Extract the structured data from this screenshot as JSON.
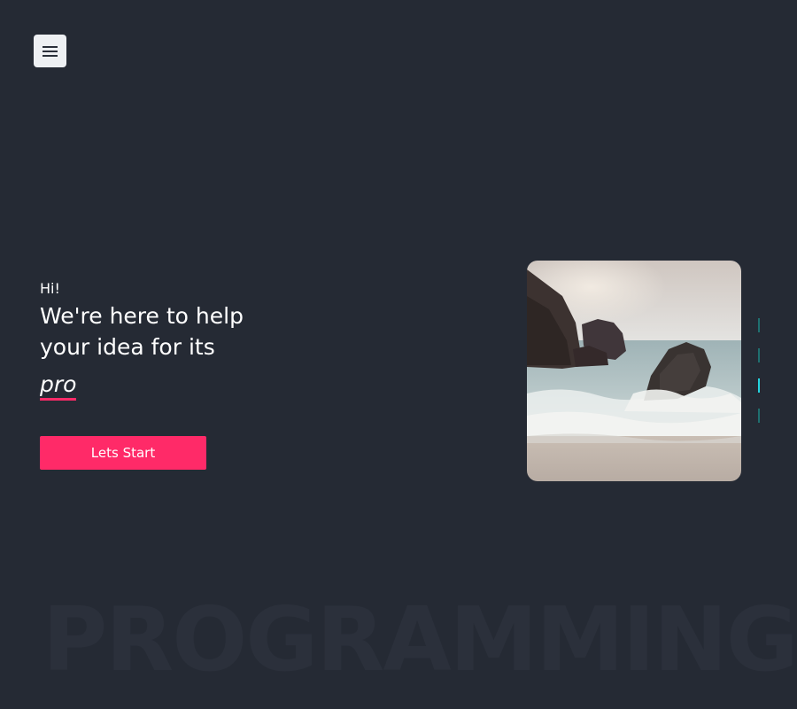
{
  "menu": {
    "icon": "hamburger-menu-icon"
  },
  "hero": {
    "greeting": "Hi!",
    "headline": "We're here to help your idea for its",
    "emphasis": "pro",
    "cta_label": "Lets Start"
  },
  "photo": {
    "subject": "rocks-in-ocean-waves-photo"
  },
  "slider": {
    "slide_count": 4,
    "active_index": 2
  },
  "background_text": "PROGRAMMING",
  "colors": {
    "background": "#252a34",
    "accent": "#ff2a68",
    "indicator": "#1f6f6f",
    "indicator_active": "#24d4e0",
    "text": "#ffffff"
  }
}
